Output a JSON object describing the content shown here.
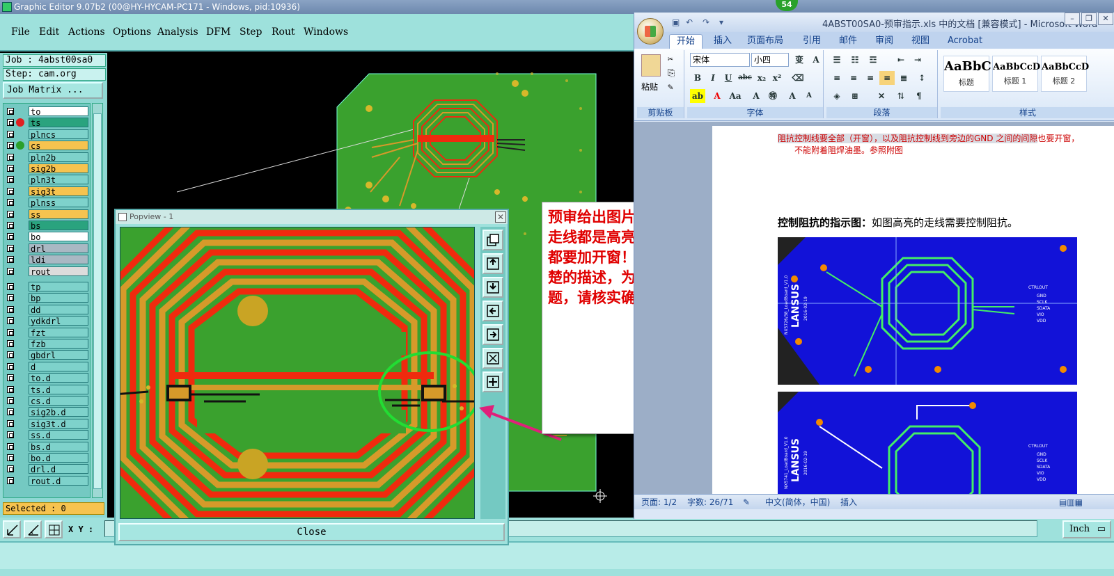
{
  "ge": {
    "title": "Graphic Editor 9.07b2 (00@HY-HYCAM-PC171 - Windows, pid:10936)",
    "menu": [
      "File",
      "Edit",
      "Actions",
      "Options",
      "Analysis",
      "DFM",
      "Step",
      "Rout",
      "Windows"
    ],
    "job": "Job : 4abst00sa0",
    "step": "Step: cam.org",
    "job_matrix": "Job Matrix ...",
    "selected": "Selected : 0",
    "xy_label": "X Y :",
    "units": "Inch",
    "layers": [
      {
        "name": "to",
        "color": "#ffffff"
      },
      {
        "name": "ts",
        "color": "#2aa37e",
        "dot": "#e02020"
      },
      {
        "name": "plncs",
        "color": "#7ed2cb"
      },
      {
        "name": "cs",
        "color": "#f6c34f",
        "dot": "#2ba02b"
      },
      {
        "name": "pln2b",
        "color": "#7ed2cb"
      },
      {
        "name": "sig2b",
        "color": "#f6c34f"
      },
      {
        "name": "pln3t",
        "color": "#7ed2cb"
      },
      {
        "name": "sig3t",
        "color": "#f6c34f"
      },
      {
        "name": "plnss",
        "color": "#7ed2cb"
      },
      {
        "name": "ss",
        "color": "#f6c34f"
      },
      {
        "name": "bs",
        "color": "#2aa37e"
      },
      {
        "name": "bo",
        "color": "#ffffff"
      },
      {
        "name": "drl",
        "color": "#a9b8c3"
      },
      {
        "name": "ldi",
        "color": "#a9b8c3"
      },
      {
        "name": "rout",
        "color": "#dcdcdc"
      },
      {
        "name": "tp",
        "color": "#7ed2cb"
      },
      {
        "name": "bp",
        "color": "#7ed2cb"
      },
      {
        "name": "dd",
        "color": "#7ed2cb"
      },
      {
        "name": "ydkdrl",
        "color": "#7ed2cb"
      },
      {
        "name": "fzt",
        "color": "#7ed2cb"
      },
      {
        "name": "fzb",
        "color": "#7ed2cb"
      },
      {
        "name": "gbdrl",
        "color": "#7ed2cb"
      },
      {
        "name": "d",
        "color": "#7ed2cb"
      },
      {
        "name": "to.d",
        "color": "#7ed2cb"
      },
      {
        "name": "ts.d",
        "color": "#7ed2cb"
      },
      {
        "name": "cs.d",
        "color": "#7ed2cb"
      },
      {
        "name": "sig2b.d",
        "color": "#7ed2cb"
      },
      {
        "name": "sig3t.d",
        "color": "#7ed2cb"
      },
      {
        "name": "ss.d",
        "color": "#7ed2cb"
      },
      {
        "name": "bs.d",
        "color": "#7ed2cb"
      },
      {
        "name": "bo.d",
        "color": "#7ed2cb"
      },
      {
        "name": "drl.d",
        "color": "#7ed2cb"
      },
      {
        "name": "rout.d",
        "color": "#7ed2cb"
      }
    ]
  },
  "popview": {
    "title": "Popview - 1",
    "close_x": "✕",
    "close_label": "Close"
  },
  "note": {
    "text": "预审给出图片貌似顶层所有的走线都是高亮的，请确认是否都要加开窗！（由于没有很清楚的描述，为了保证不出问题，请核实确认）"
  },
  "badge": "54",
  "word": {
    "title": "4ABST00SA0-预审指示.xls 中的文档 [兼容模式] - Microsoft Word",
    "tabs": [
      "开始",
      "插入",
      "页面布局",
      "引用",
      "邮件",
      "审阅",
      "视图",
      "Acrobat"
    ],
    "font_name": "宋体",
    "font_size": "小四",
    "groups": {
      "clipboard": "剪贴板",
      "paste": "粘贴",
      "font": "字体",
      "paragraph": "段落",
      "styles": "样式"
    },
    "styles": [
      {
        "sample": "AaBbC",
        "name": "标题"
      },
      {
        "sample": "AaBbCcD",
        "name": "标题 1"
      },
      {
        "sample": "AaBbCcD",
        "name": "标题 2"
      }
    ],
    "doc_line1_a": "阻抗控制线要全部（开窗），以及阻抗控制线到旁边的GND 之间的间隙",
    "doc_line1_b": "也要开窗，",
    "doc_line2": "不能附着阻焊油墨。参照附图",
    "heading_bold": "控制阻抗的指示图：",
    "heading_rest": "如图高亮的走线需要控制阻抗。",
    "pcb_text": {
      "brand": "LANSUS",
      "board1": "NX5726/38_LoadBoard_V1.0",
      "date": "2016-02-19",
      "board2": "NX5741_LoadBoard_V1.0",
      "ctrl": "CTRLOUT",
      "pins": [
        "GND",
        "SCLK",
        "SDATA",
        "VIO",
        "VDD"
      ]
    },
    "status": {
      "page": "页面: 1/2",
      "words": "字数: 26/71",
      "lang": "中文(简体，中国)",
      "mode": "插入"
    }
  },
  "colors": {
    "pcb_green": "#3aa12e",
    "trace_red": "#f02a0e",
    "trace_gold": "#d69a2a",
    "word_blue": "#1212d8",
    "annot_arrow": "#e0207a",
    "highlight_green": "#22dd33"
  }
}
